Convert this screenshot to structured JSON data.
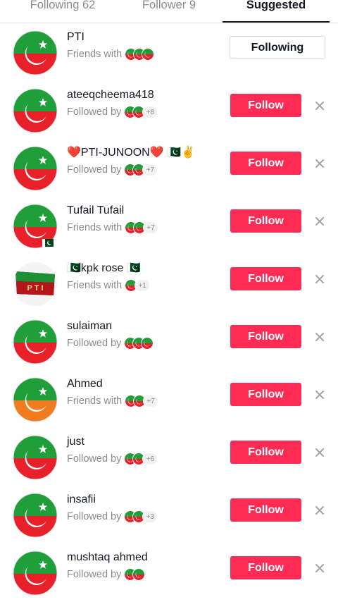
{
  "tabs": [
    {
      "label": "Following 62"
    },
    {
      "label": "Follower 9"
    },
    {
      "label": "Suggested"
    }
  ],
  "colors": {
    "accent": "#fe2c55",
    "pti_red": "#e8202a",
    "pti_green": "#1f9e3a"
  },
  "rows": [
    {
      "name": "PTI",
      "sub": "Friends with",
      "button": "Following",
      "mini": 3,
      "plus": ""
    },
    {
      "name": "ateeqcheema418",
      "sub": "Followed by",
      "button": "Follow",
      "mini": 2,
      "plus": "+8"
    },
    {
      "name": "❤️PTI-JUNOON❤️ 🇵🇰✌️",
      "sub": "Followed by",
      "button": "Follow",
      "mini": 2,
      "plus": "+7"
    },
    {
      "name": "Tufail Tufail",
      "sub": "Friends with",
      "button": "Follow",
      "mini": 2,
      "plus": "+7"
    },
    {
      "name": "🇵🇰kpk rose 🇵🇰",
      "sub": "Friends with",
      "button": "Follow",
      "mini": 1,
      "plus": "+1"
    },
    {
      "name": "sulaiman",
      "sub": "Followed by",
      "button": "Follow",
      "mini": 3,
      "plus": ""
    },
    {
      "name": "Ahmed",
      "sub": "Friends with",
      "button": "Follow",
      "mini": 2,
      "plus": "+7"
    },
    {
      "name": "just",
      "sub": "Followed by",
      "button": "Follow",
      "mini": 2,
      "plus": "+6"
    },
    {
      "name": "insafii",
      "sub": "Followed by",
      "button": "Follow",
      "mini": 2,
      "plus": "+3"
    },
    {
      "name": "mushtaq ahmed",
      "sub": "Followed by",
      "button": "Follow",
      "mini": 2,
      "plus": ""
    }
  ]
}
